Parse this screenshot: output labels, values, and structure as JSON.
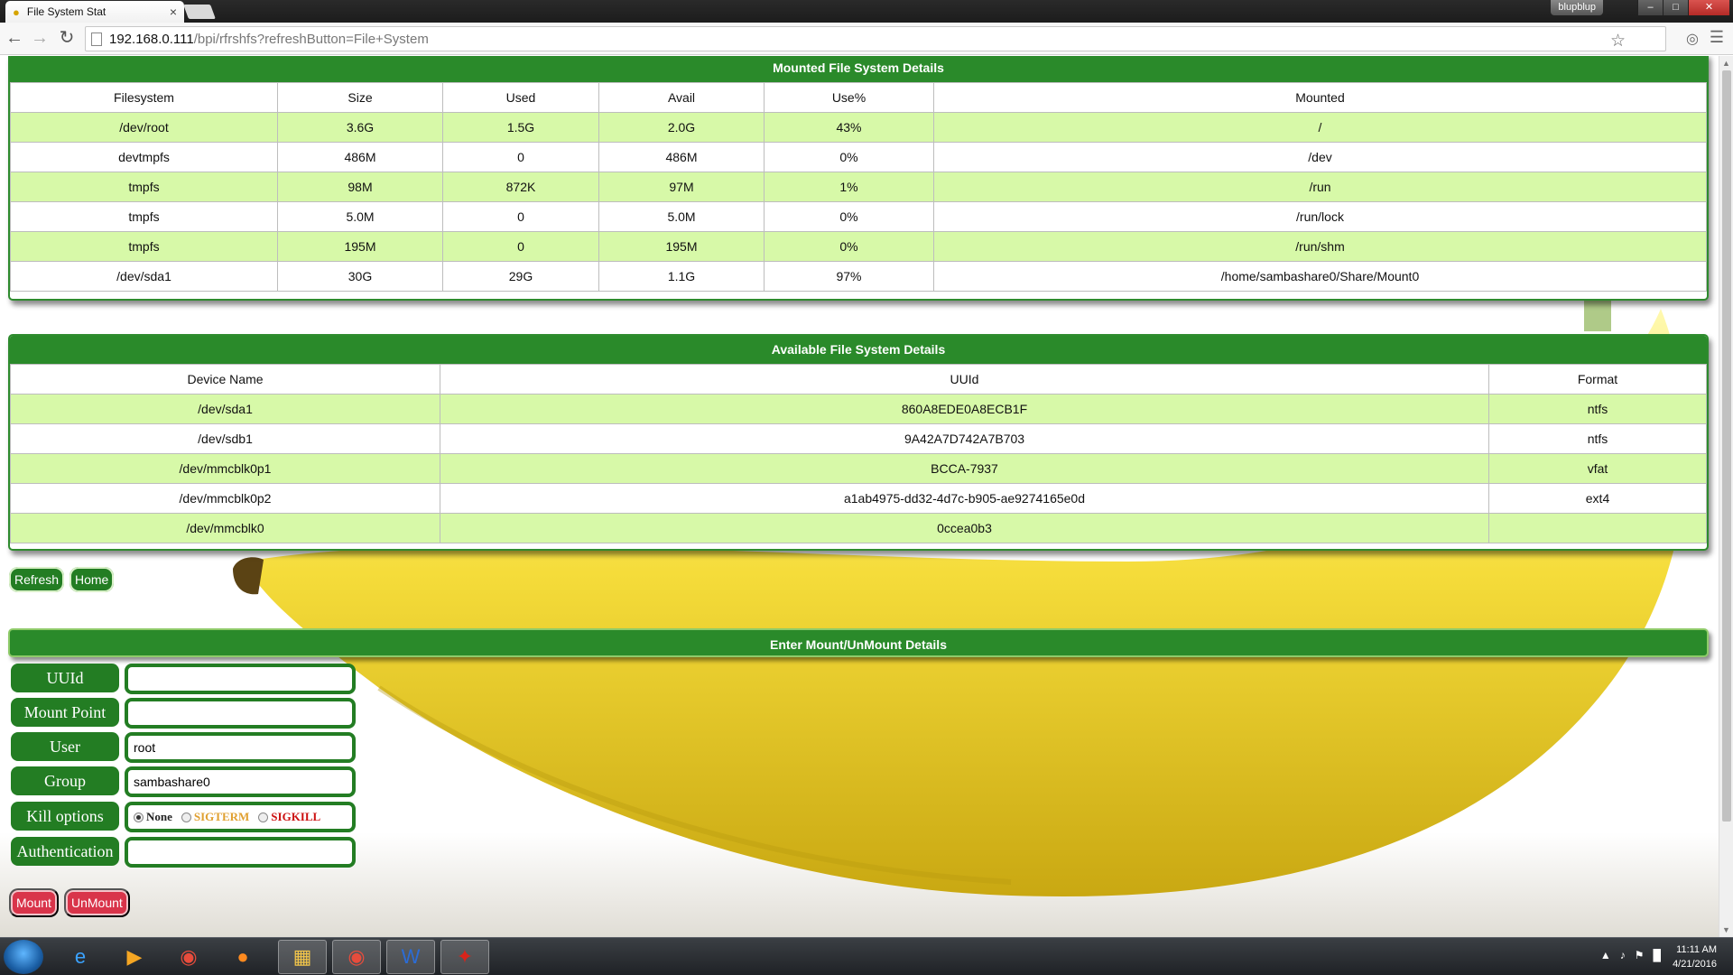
{
  "browser": {
    "tab_title": "File System Stat",
    "tab_close": "×",
    "user_badge": "blupblup",
    "url_host": "192.168.0.111",
    "url_path": "/bpi/rfrshfs?refreshButton=File+System"
  },
  "mounted": {
    "title": "Mounted File System Details",
    "headers": [
      "Filesystem",
      "Size",
      "Used",
      "Avail",
      "Use%",
      "Mounted"
    ],
    "rows": [
      [
        "/dev/root",
        "3.6G",
        "1.5G",
        "2.0G",
        "43%",
        "/"
      ],
      [
        "devtmpfs",
        "486M",
        "0",
        "486M",
        "0%",
        "/dev"
      ],
      [
        "tmpfs",
        "98M",
        "872K",
        "97M",
        "1%",
        "/run"
      ],
      [
        "tmpfs",
        "5.0M",
        "0",
        "5.0M",
        "0%",
        "/run/lock"
      ],
      [
        "tmpfs",
        "195M",
        "0",
        "195M",
        "0%",
        "/run/shm"
      ],
      [
        "/dev/sda1",
        "30G",
        "29G",
        "1.1G",
        "97%",
        "/home/sambashare0/Share/Mount0"
      ]
    ]
  },
  "available": {
    "title": "Available File System Details",
    "headers": [
      "Device Name",
      "UUId",
      "Format"
    ],
    "rows": [
      [
        "/dev/sda1",
        "860A8EDE0A8ECB1F",
        "ntfs"
      ],
      [
        "/dev/sdb1",
        "9A42A7D742A7B703",
        "ntfs"
      ],
      [
        "/dev/mmcblk0p1",
        "BCCA-7937",
        "vfat"
      ],
      [
        "/dev/mmcblk0p2",
        "a1ab4975-dd32-4d7c-b905-ae9274165e0d",
        "ext4"
      ],
      [
        "/dev/mmcblk0",
        "0ccea0b3",
        ""
      ]
    ]
  },
  "buttons": {
    "refresh": "Refresh",
    "home": "Home",
    "mount": "Mount",
    "unmount": "UnMount"
  },
  "form": {
    "title": "Enter Mount/UnMount Details",
    "uuid_label": "UUId",
    "uuid_value": "",
    "mount_point_label": "Mount Point",
    "mount_point_value": "",
    "user_label": "User",
    "user_value": "root",
    "group_label": "Group",
    "group_value": "sambashare0",
    "kill_label": "Kill options",
    "kill_options": [
      "None",
      "SIGTERM",
      "SIGKILL"
    ],
    "kill_selected": "None",
    "auth_label": "Authentication",
    "auth_value": ""
  },
  "taskbar": {
    "time": "11:11 AM",
    "date": "4/21/2016"
  },
  "colors": {
    "header_green": "#2a8a2a",
    "row_green": "#d7f9a8",
    "button_red": "#d9344a",
    "sigterm": "#e0a030",
    "sigkill": "#cc1111"
  }
}
